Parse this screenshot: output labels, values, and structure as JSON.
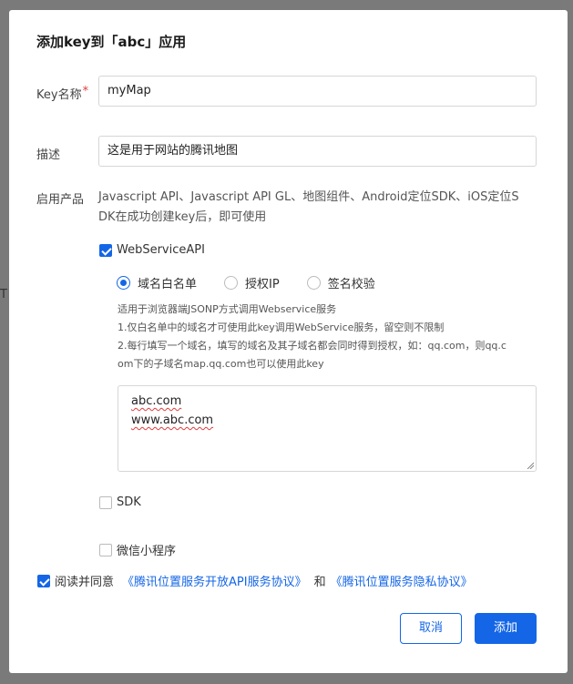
{
  "background": {
    "stray_char": "T"
  },
  "dialog": {
    "title": "添加key到「abc」应用",
    "key_name": {
      "label": "Key名称",
      "required_mark": "*",
      "value": "myMap"
    },
    "description": {
      "label": "描述",
      "value": "这是用于网站的腾讯地图"
    },
    "products": {
      "label": "启用产品",
      "desc_line1": "Javascript API、Javascript API GL、地图组件、Android定位SDK、iOS定位S",
      "desc_line2": "DK在成功创建key后，即可使用",
      "webservice": {
        "label": "WebServiceAPI",
        "checked": true
      },
      "radio_options": [
        {
          "label": "域名白名单",
          "selected": true
        },
        {
          "label": "授权IP",
          "selected": false
        },
        {
          "label": "签名校验",
          "selected": false
        }
      ],
      "help_lines": [
        "适用于浏览器端JSONP方式调用Webservice服务",
        "1.仅白名单中的域名才可使用此key调用WebService服务，留空则不限制",
        "2.每行填写一个域名，填写的域名及其子域名都会同时得到授权，如：qq.com，则qq.c",
        "om下的子域名map.qq.com也可以使用此key"
      ],
      "domains": [
        "abc.com",
        "www.abc.com"
      ],
      "sdk": {
        "label": "SDK",
        "checked": false
      },
      "miniprogram": {
        "label": "微信小程序",
        "checked": false
      }
    },
    "agreement": {
      "checked": true,
      "prefix": "阅读并同意",
      "link1": "《腾讯位置服务开放API服务协议》",
      "and": "和",
      "link2": "《腾讯位置服务隐私协议》"
    },
    "buttons": {
      "cancel": "取消",
      "add": "添加"
    }
  },
  "colors": {
    "accent": "#1466e6",
    "required": "#e03c3c",
    "overlay": "#7a7a7a"
  }
}
